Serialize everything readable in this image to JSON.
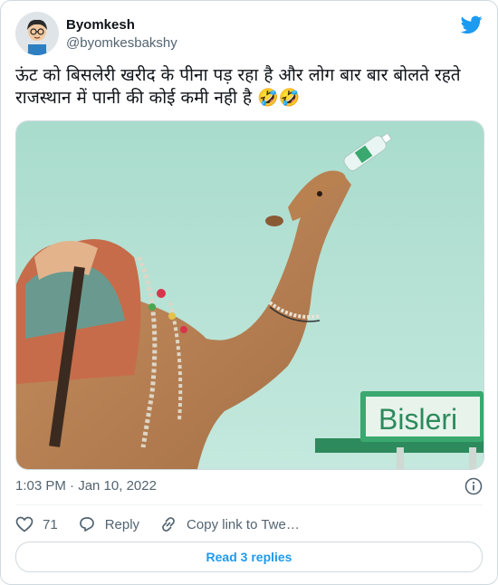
{
  "author": {
    "display_name": "Byomkesh",
    "handle": "@byomkesbakshy"
  },
  "tweet": {
    "text_line1": "ऊंट को बिसलेरी खरीद के पीना पड़ रहा है और लोग बार बार बोलते रहते",
    "text_line2": "राजस्थान में पानी की कोई कमी नही है 🤣🤣",
    "timestamp": "1:03 PM · Jan 10, 2022"
  },
  "media": {
    "sign_text": "Bisleri"
  },
  "actions": {
    "like_count": "71",
    "reply_label": "Reply",
    "copy_link_label": "Copy link to Twe…"
  },
  "replies_button": "Read 3 replies",
  "colors": {
    "twitter_blue": "#1d9bf0",
    "secondary_text": "#536471",
    "border": "#cfd9de"
  },
  "icons": [
    "bird-icon",
    "info-icon",
    "heart-icon",
    "reply-icon",
    "link-icon"
  ]
}
